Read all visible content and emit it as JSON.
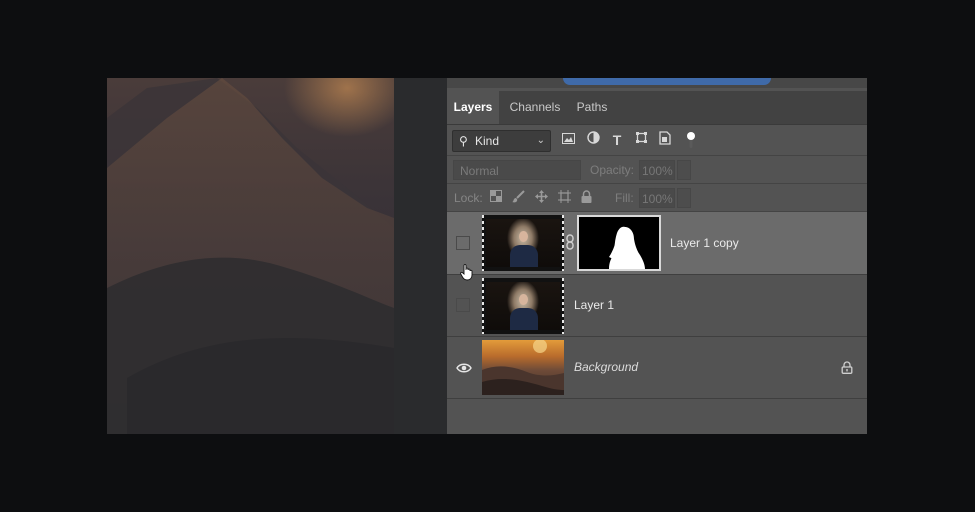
{
  "tabs": [
    {
      "label": "Layers",
      "active": true
    },
    {
      "label": "Channels",
      "active": false
    },
    {
      "label": "Paths",
      "active": false
    }
  ],
  "filter": {
    "kind_label": "Kind",
    "icons": [
      "image-filter-icon",
      "adjustment-filter-icon",
      "type-filter-icon",
      "shape-filter-icon",
      "smart-object-filter-icon",
      "filter-toggle-icon"
    ]
  },
  "blend": {
    "mode": "Normal",
    "opacity_label": "Opacity:",
    "opacity_value": "100%"
  },
  "lock": {
    "label": "Lock:",
    "icons": [
      "lock-transparent-pixels-icon",
      "lock-image-pixels-icon",
      "lock-position-icon",
      "lock-artboard-icon",
      "lock-all-icon"
    ],
    "fill_label": "Fill:",
    "fill_value": "100%"
  },
  "layers": [
    {
      "name": "Layer 1 copy",
      "visible": false,
      "selected": true,
      "has_mask": true,
      "italic": false
    },
    {
      "name": "Layer 1",
      "visible": false,
      "selected": false,
      "has_mask": false,
      "italic": false
    },
    {
      "name": "Background",
      "visible": true,
      "selected": false,
      "has_mask": false,
      "italic": true,
      "locked": true
    }
  ],
  "colors": {
    "panel_bg": "#535353",
    "selected_layer_bg": "#6b6b6b",
    "tab_bar_bg": "#424242",
    "app_bg": "#0d0e10"
  }
}
